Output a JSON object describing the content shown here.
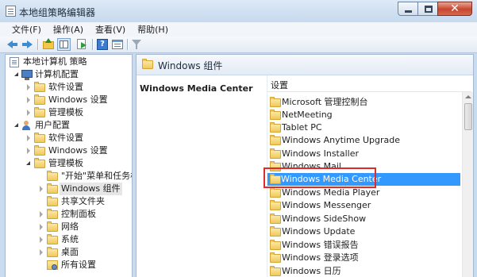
{
  "window": {
    "title": "本地组策略编辑器",
    "minimize_label": "",
    "maximize_label": "",
    "close_glyph": "✕"
  },
  "menubar": {
    "items": [
      {
        "label": "文件(F)"
      },
      {
        "label": "操作(A)"
      },
      {
        "label": "查看(V)"
      },
      {
        "label": "帮助(H)"
      }
    ]
  },
  "toolbar": {
    "help_glyph": "?"
  },
  "tree": {
    "nodes": [
      {
        "label": "本地计算机 策略",
        "icon": "policy-icon"
      },
      {
        "label": "计算机配置",
        "icon": "computer-icon",
        "expanded": true
      },
      {
        "label": "软件设置",
        "icon": "folder-icon",
        "expanded": false
      },
      {
        "label": "Windows 设置",
        "icon": "folder-icon",
        "expanded": false
      },
      {
        "label": "管理模板",
        "icon": "folder-icon",
        "expanded": false
      },
      {
        "label": "用户配置",
        "icon": "user-icon",
        "expanded": true
      },
      {
        "label": "软件设置",
        "icon": "folder-icon",
        "expanded": false
      },
      {
        "label": "Windows 设置",
        "icon": "folder-icon",
        "expanded": false
      },
      {
        "label": "管理模板",
        "icon": "folder-icon",
        "expanded": true
      },
      {
        "label": "\"开始\"菜单和任务栏",
        "icon": "folder-icon"
      },
      {
        "label": "Windows 组件",
        "icon": "folder-icon",
        "expanded": false,
        "selected": true
      },
      {
        "label": "共享文件夹",
        "icon": "folder-icon"
      },
      {
        "label": "控制面板",
        "icon": "folder-icon",
        "expanded": false
      },
      {
        "label": "网络",
        "icon": "folder-icon",
        "expanded": false
      },
      {
        "label": "系统",
        "icon": "folder-icon",
        "expanded": false
      },
      {
        "label": "桌面",
        "icon": "folder-icon",
        "expanded": false
      },
      {
        "label": "所有设置",
        "icon": "settings-icon"
      }
    ]
  },
  "main": {
    "header_title": "Windows 组件",
    "description_title": "Windows Media Center",
    "column_header": "设置",
    "items": [
      {
        "label": "Microsoft 管理控制台"
      },
      {
        "label": "NetMeeting"
      },
      {
        "label": "Tablet PC"
      },
      {
        "label": "Windows Anytime Upgrade"
      },
      {
        "label": "Windows Installer"
      },
      {
        "label": "Windows Mail"
      },
      {
        "label": "Windows Media Center",
        "selected": true,
        "highlighted": true
      },
      {
        "label": "Windows Media Player"
      },
      {
        "label": "Windows Messenger"
      },
      {
        "label": "Windows SideShow"
      },
      {
        "label": "Windows Update"
      },
      {
        "label": "Windows 错误报告"
      },
      {
        "label": "Windows 登录选项"
      },
      {
        "label": "Windows 日历"
      }
    ]
  },
  "colors": {
    "selection": "#3399ff",
    "highlight_box": "#e02b2b",
    "folder": "#f0c95a"
  }
}
